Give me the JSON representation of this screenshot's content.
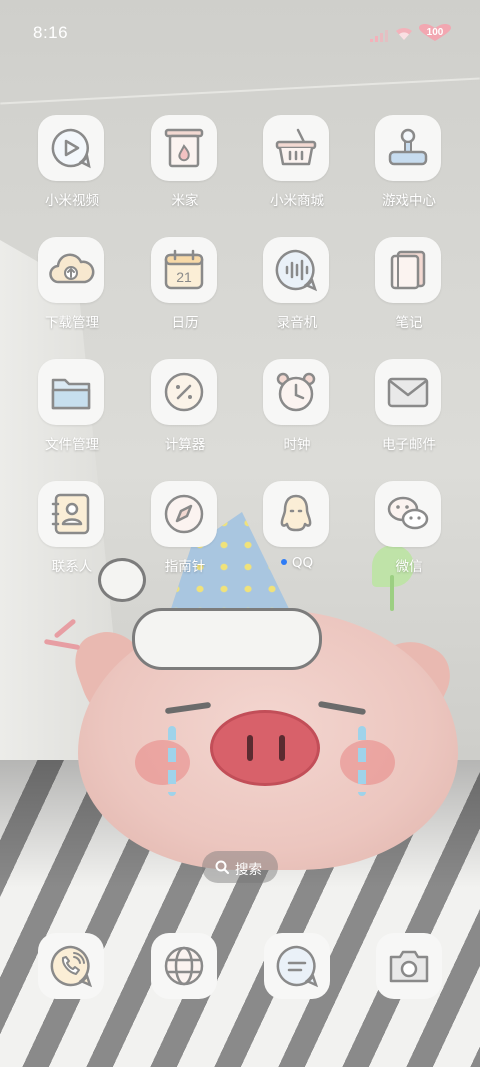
{
  "status_bar": {
    "time": "8:16",
    "battery": "100",
    "icons": [
      "cellular-signal-icon",
      "wifi-icon",
      "battery-icon"
    ]
  },
  "apps": [
    {
      "label": "小米视频",
      "icon": "video-play-icon"
    },
    {
      "label": "米家",
      "icon": "fireplace-home-icon"
    },
    {
      "label": "小米商城",
      "icon": "shopping-basket-icon"
    },
    {
      "label": "游戏中心",
      "icon": "joystick-icon"
    },
    {
      "label": "下载管理",
      "icon": "cloud-upload-icon"
    },
    {
      "label": "日历",
      "icon": "calendar-icon",
      "calendar_day": "21"
    },
    {
      "label": "录音机",
      "icon": "voice-recorder-icon"
    },
    {
      "label": "笔记",
      "icon": "notebook-icon"
    },
    {
      "label": "文件管理",
      "icon": "folder-icon"
    },
    {
      "label": "计算器",
      "icon": "calculator-icon"
    },
    {
      "label": "时钟",
      "icon": "alarm-clock-icon"
    },
    {
      "label": "电子邮件",
      "icon": "envelope-icon"
    },
    {
      "label": "联系人",
      "icon": "contact-card-icon"
    },
    {
      "label": "指南针",
      "icon": "compass-icon"
    },
    {
      "label": "QQ",
      "icon": "qq-penguin-icon",
      "has_update_dot": true
    },
    {
      "label": "微信",
      "icon": "wechat-bubbles-icon"
    }
  ],
  "search": {
    "label": "搜索"
  },
  "dock": [
    {
      "icon": "phone-icon"
    },
    {
      "icon": "browser-globe-icon"
    },
    {
      "icon": "messages-icon"
    },
    {
      "icon": "camera-icon"
    }
  ],
  "colors": {
    "icon_bg": "#f7f7f6",
    "icon_stroke": "#8a8a8a",
    "accent_dot": "#2e7cf6",
    "battery_heart": "#f2a7b1"
  }
}
